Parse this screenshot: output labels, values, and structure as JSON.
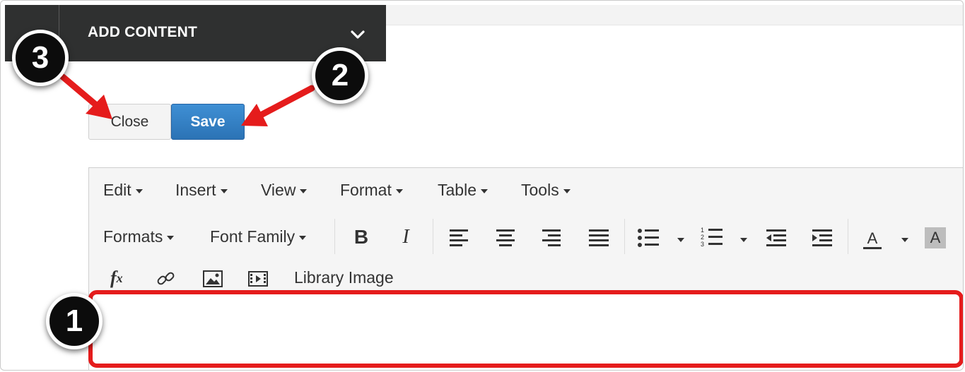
{
  "header": {
    "title": "ADD CONTENT",
    "collapse_icon": "chevron-down-icon"
  },
  "actions": {
    "close_label": "Close",
    "save_label": "Save"
  },
  "editor": {
    "menubar": [
      {
        "label": "Edit"
      },
      {
        "label": "Insert"
      },
      {
        "label": "View"
      },
      {
        "label": "Format"
      },
      {
        "label": "Table"
      },
      {
        "label": "Tools"
      }
    ],
    "toolbar": {
      "formats_label": "Formats",
      "font_family_label": "Font Family",
      "bold_label": "B",
      "italic_label": "I",
      "text_color_label": "A",
      "bg_color_label": "A",
      "library_image_label": "Library Image"
    },
    "icons": [
      "align-left-icon",
      "align-center-icon",
      "align-right-icon",
      "align-justify-icon",
      "bullet-list-icon",
      "numbered-list-icon",
      "outdent-icon",
      "indent-icon",
      "formula-icon",
      "link-icon",
      "image-icon",
      "media-icon"
    ]
  },
  "callouts": {
    "one": "1",
    "two": "2",
    "three": "3"
  },
  "colors": {
    "accent_red": "#e51c1c",
    "save_blue": "#2b73b5",
    "header_dark": "#2f3030"
  }
}
